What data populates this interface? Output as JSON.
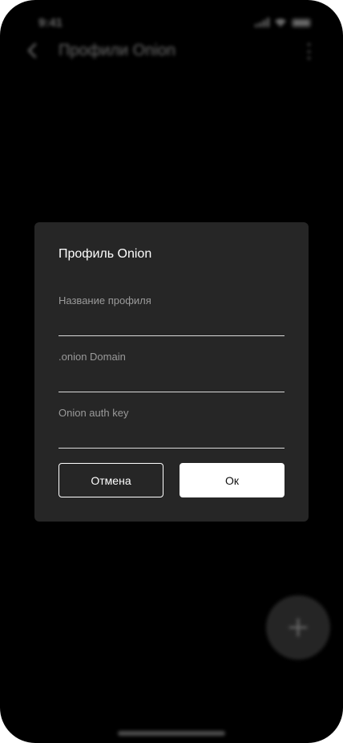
{
  "status_bar": {
    "time": "9:41"
  },
  "app_bar": {
    "title": "Профили Onion"
  },
  "dialog": {
    "title": "Профиль Onion",
    "fields": [
      {
        "label": "Название профиля",
        "value": ""
      },
      {
        "label": ".onion Domain",
        "value": ""
      },
      {
        "label": "Onion auth key",
        "value": ""
      }
    ],
    "cancel_label": "Отмена",
    "ok_label": "Ок"
  },
  "icons": {
    "back": "chevron-left-icon",
    "more": "more-vertical-icon",
    "fab": "plus-icon"
  },
  "colors": {
    "background": "#000000",
    "dialog": "#262626",
    "primary_button": "#ffffff",
    "label": "#9a9a9a"
  }
}
